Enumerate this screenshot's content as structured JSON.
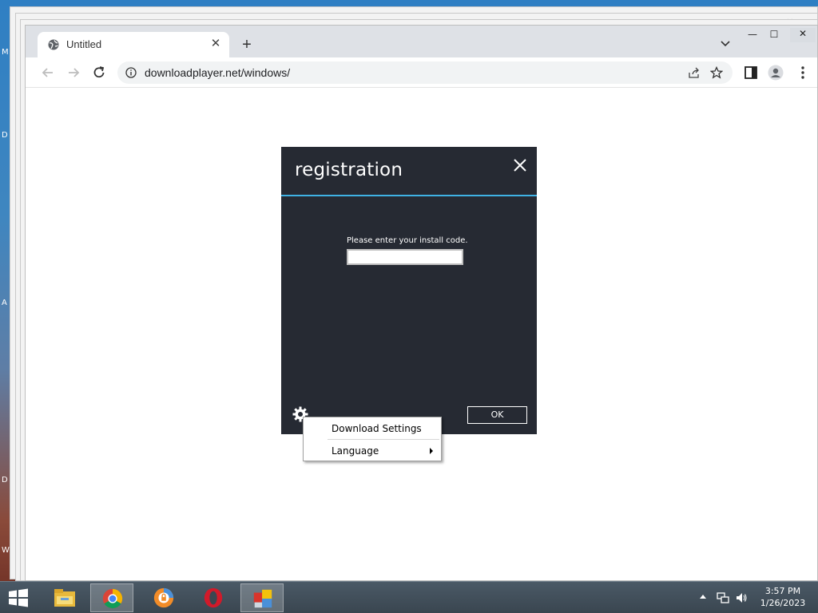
{
  "desktop": {
    "side_letters": [
      "M",
      "D",
      "A",
      "D",
      "W"
    ]
  },
  "browser": {
    "tab": {
      "title": "Untitled",
      "close_glyph": "✕"
    },
    "new_tab_glyph": "+",
    "window_controls": {
      "minimize": "—",
      "maximize": "☐",
      "close": "✕"
    },
    "address": {
      "url": "downloadplayer.net/windows/"
    }
  },
  "dialog": {
    "title": "registration",
    "prompt": "Please enter your install code.",
    "input_value": "",
    "ok_label": "OK",
    "accent_color": "#3fb2e4",
    "background_color": "#262a33"
  },
  "context_menu": {
    "items": [
      {
        "label": "Download Settings",
        "has_submenu": false
      },
      {
        "label": "Language",
        "has_submenu": true
      }
    ]
  },
  "taskbar": {
    "apps": [
      "file-explorer-icon",
      "chrome-icon",
      "avast-secure-browser-icon",
      "opera-icon",
      "installer-icon"
    ],
    "clock": {
      "time": "3:57 PM",
      "date": "1/26/2023"
    }
  }
}
